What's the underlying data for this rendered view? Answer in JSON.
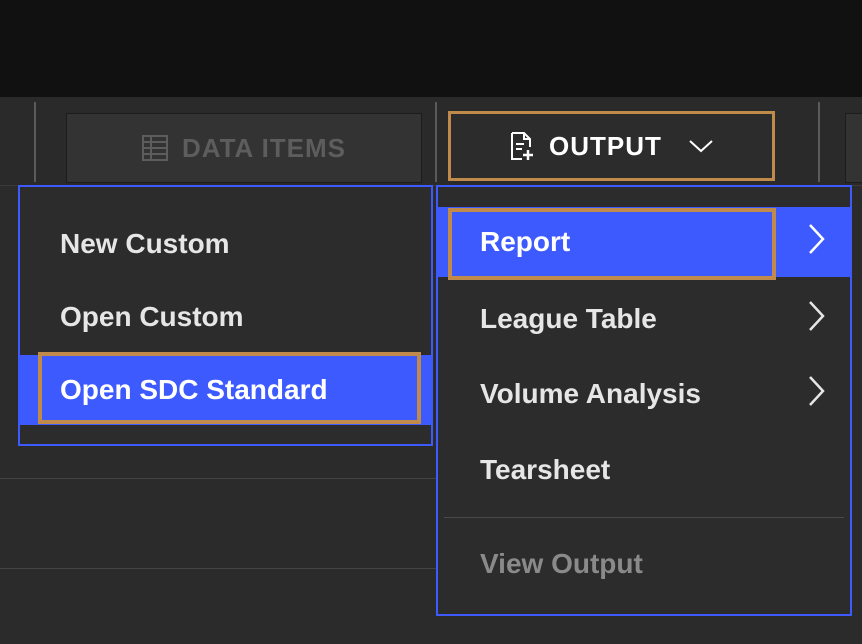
{
  "toolbar": {
    "data_items_label": "DATA ITEMS",
    "output_label": "OUTPUT"
  },
  "left_menu": {
    "items": [
      {
        "label": "New Custom"
      },
      {
        "label": "Open Custom"
      },
      {
        "label": "Open SDC Standard",
        "highlighted": true
      }
    ]
  },
  "right_menu": {
    "items": [
      {
        "label": "Report",
        "highlighted": true,
        "submenu": true
      },
      {
        "label": "League Table",
        "submenu": true
      },
      {
        "label": "Volume Analysis",
        "submenu": true
      },
      {
        "label": "Tearsheet"
      },
      {
        "label": "View Output",
        "disabled": true
      }
    ]
  },
  "colors": {
    "menu_highlight": "#3d5afe",
    "menu_border": "#3d5afe",
    "annotation_box": "#c08a4b",
    "background": "#2b2b2b",
    "topbar": "#111111"
  },
  "icons": {
    "data_items": "table-grid-icon",
    "output": "document-export-icon",
    "output_dropdown": "chevron-down-icon",
    "submenu": "chevron-right-icon"
  }
}
